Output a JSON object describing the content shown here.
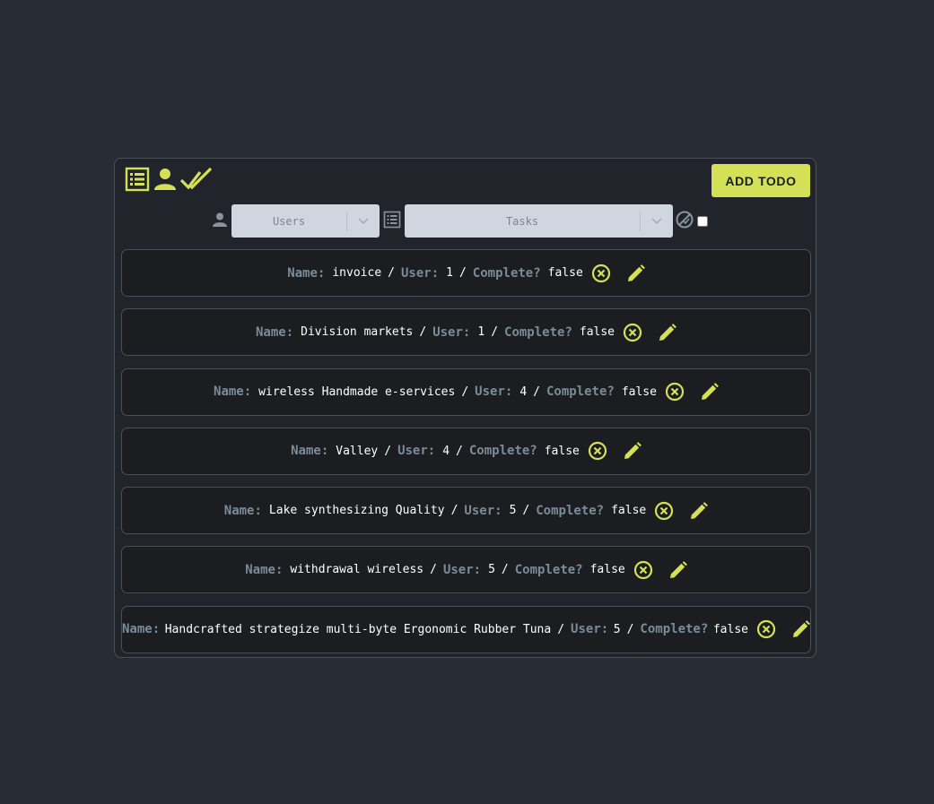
{
  "header": {
    "icons": [
      "list-icon",
      "user-icon",
      "double-check-icon"
    ],
    "add_button_label": "ADD TODO"
  },
  "filters": {
    "users_placeholder": "Users",
    "tasks_placeholder": "Tasks",
    "complete_checked": false
  },
  "labels": {
    "name": "Name:",
    "user": "User:",
    "complete": "Complete?",
    "separator": "/"
  },
  "todos": [
    {
      "name": "invoice",
      "user": "1",
      "complete": "false"
    },
    {
      "name": "Division markets",
      "user": "1",
      "complete": "false"
    },
    {
      "name": "wireless Handmade e-services",
      "user": "4",
      "complete": "false"
    },
    {
      "name": "Valley",
      "user": "4",
      "complete": "false"
    },
    {
      "name": "Lake synthesizing Quality",
      "user": "5",
      "complete": "false"
    },
    {
      "name": "withdrawal wireless",
      "user": "5",
      "complete": "false"
    },
    {
      "name": "Handcrafted strategize multi-byte Ergonomic Rubber Tuna",
      "user": "5",
      "complete": "false"
    }
  ],
  "colors": {
    "accent": "#d4e157",
    "background": "#282c34",
    "panel": "#21252b",
    "row": "#1b1d21",
    "label": "#7a8b99",
    "select": "#d0d6df"
  }
}
